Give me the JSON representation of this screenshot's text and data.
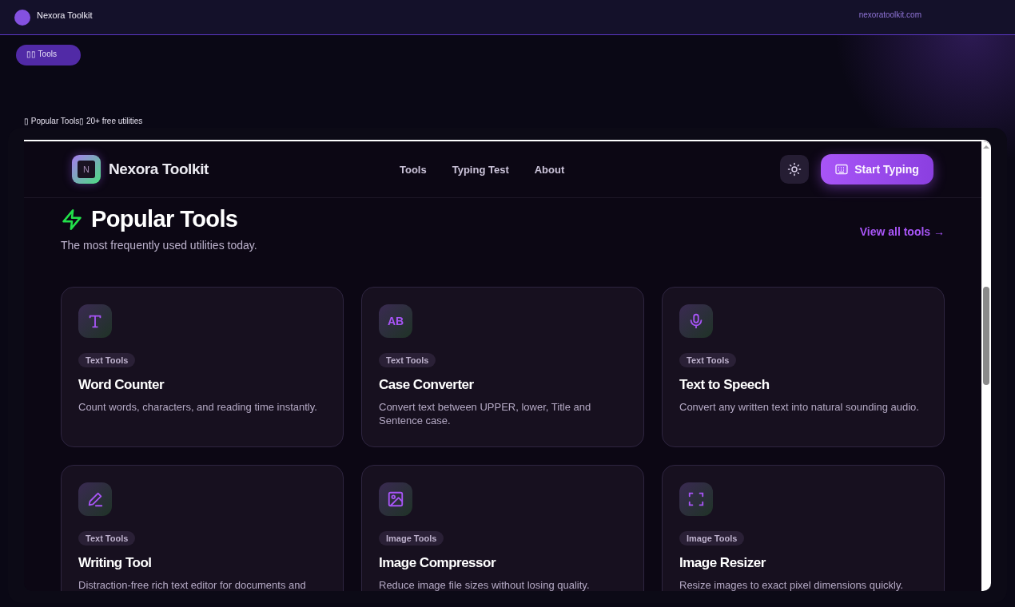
{
  "topbar": {
    "title": "Nexora Toolkit",
    "url": "nexoratoolkit.com"
  },
  "pill": {
    "label": "▯▯ Tools"
  },
  "caption": "▯ Popular Tools▯ 20+ free utilities",
  "site": {
    "brand": "Nexora Toolkit",
    "logo_letter": "N",
    "nav": [
      {
        "label": "Tools"
      },
      {
        "label": "Typing Test"
      },
      {
        "label": "About"
      }
    ],
    "cta": "Start Typing",
    "section": {
      "title": "Popular Tools",
      "subtitle": "The most frequently used utilities today.",
      "link": "View all tools →"
    },
    "cards": [
      {
        "kind": "text",
        "tag": "Text Tools",
        "title": "Word Counter",
        "desc": "Count words, characters, and reading time instantly."
      },
      {
        "kind": "letters",
        "icon_text": "AB",
        "tag": "Text Tools",
        "title": "Case Converter",
        "desc": "Convert text between UPPER, lower, Title and Sentence case."
      },
      {
        "kind": "mic",
        "tag": "Text Tools",
        "title": "Text to Speech",
        "desc": "Convert any written text into natural sounding audio."
      },
      {
        "kind": "pen",
        "tag": "Text Tools",
        "title": "Writing Tool",
        "desc": "Distraction-free rich text editor for documents and"
      },
      {
        "kind": "image",
        "tag": "Image Tools",
        "title": "Image Compressor",
        "desc": "Reduce image file sizes without losing quality."
      },
      {
        "kind": "frame",
        "tag": "Image Tools",
        "title": "Image Resizer",
        "desc": "Resize images to exact pixel dimensions quickly."
      }
    ]
  }
}
